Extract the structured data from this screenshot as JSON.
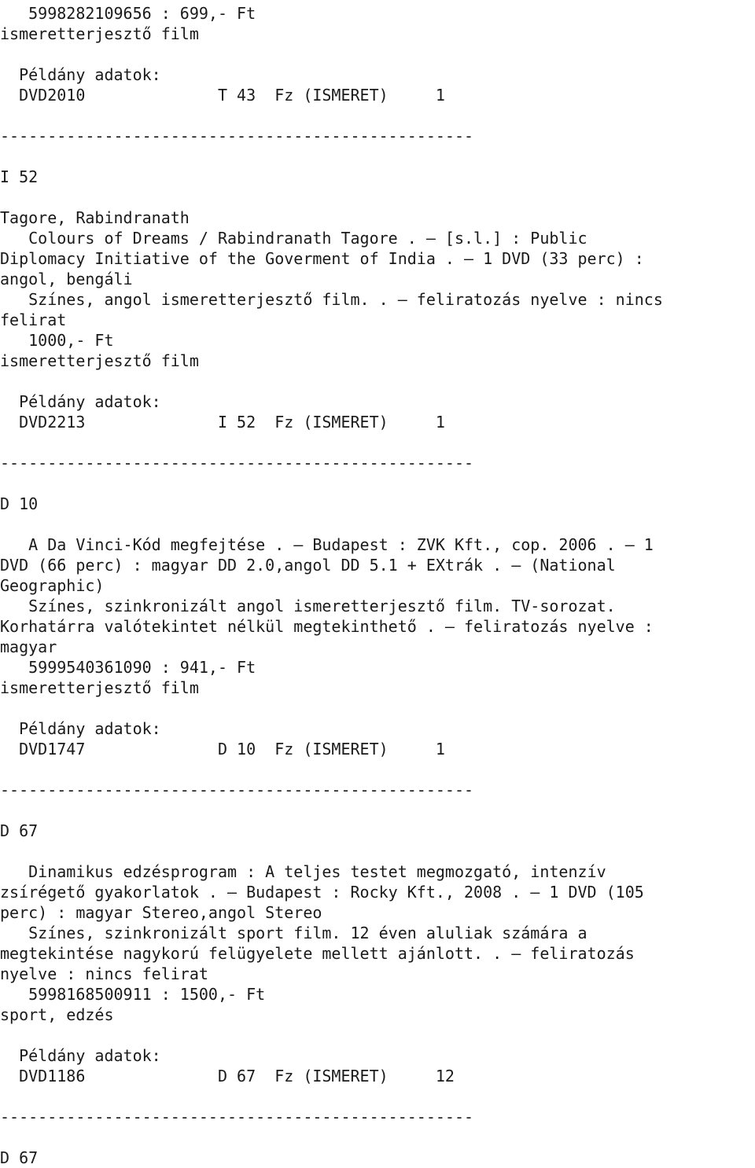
{
  "document": {
    "type": "library-catalog-printout",
    "language": "hu",
    "separator": "--------------------------------------------------",
    "records": [
      {
        "id": "record-0-partial",
        "lines": [
          "   5998282109656 : 699,- Ft",
          "ismeretterjesztő film",
          "",
          "  Példány adatok:",
          "  DVD2010              T 43  Fz (ISMERET)     1",
          "",
          "--------------------------------------------------"
        ],
        "isbn": "5998282109656",
        "price": "699,- Ft",
        "subject": "ismeretterjesztő film",
        "copy_header": "Példány adatok:",
        "copy": {
          "barcode": "DVD2010",
          "shelfmark": "T 43",
          "type": "Fz (ISMERET)",
          "count": "1"
        }
      },
      {
        "id": "record-1",
        "shelfmark_heading": "I 52",
        "author": "Tagore, Rabindranath",
        "lines": [
          "I 52",
          "",
          "Tagore, Rabindranath",
          "   Colours of Dreams / Rabindranath Tagore . — [s.l.] : Public",
          "Diplomacy Initiative of the Goverment of India . — 1 DVD (33 perc) :",
          "angol, bengáli",
          "   Színes, angol ismeretterjesztő film. . — feliratozás nyelve : nincs",
          "felirat",
          "   1000,- Ft",
          "ismeretterjesztő film",
          "",
          "  Példány adatok:",
          "  DVD2213              I 52  Fz (ISMERET)     1",
          "",
          "--------------------------------------------------"
        ],
        "title": "Colours of Dreams",
        "statement_of_responsibility": "Rabindranath Tagore",
        "place": "[s.l.]",
        "publisher": "Public Diplomacy Initiative of the Goverment of India",
        "extent": "1 DVD (33 perc)",
        "languages": "angol, bengáli",
        "note": "Színes, angol ismeretterjesztő film.",
        "subtitle_language": "nincs felirat",
        "price": "1000,- Ft",
        "subject": "ismeretterjesztő film",
        "copy_header": "Példány adatok:",
        "copy": {
          "barcode": "DVD2213",
          "shelfmark": "I 52",
          "type": "Fz (ISMERET)",
          "count": "1"
        }
      },
      {
        "id": "record-2",
        "shelfmark_heading": "D 10",
        "lines": [
          "D 10",
          "",
          "   A Da Vinci-Kód megfejtése . — Budapest : ZVK Kft., cop. 2006 . — 1",
          "DVD (66 perc) : magyar DD 2.0,angol DD 5.1 + EXtrák . — (National",
          "Geographic)",
          "   Színes, szinkronizált angol ismeretterjesztő film. TV-sorozat.",
          "Korhatárra valótekintet nélkül megtekinthető . — feliratozás nyelve :",
          "magyar",
          "   5999540361090 : 941,- Ft",
          "ismeretterjesztő film",
          "",
          "  Példány adatok:",
          "  DVD1747              D 10  Fz (ISMERET)     1",
          "",
          "--------------------------------------------------"
        ],
        "title": "A Da Vinci-Kód megfejtése",
        "place": "Budapest",
        "publisher": "ZVK Kft.",
        "date": "cop. 2006",
        "extent": "1 DVD (66 perc)",
        "sound": "magyar DD 2.0,angol DD 5.1 + EXtrák",
        "series": "(National Geographic)",
        "note": "Színes, szinkronizált angol ismeretterjesztő film. TV-sorozat. Korhatárra valótekintet nélkül megtekinthető",
        "subtitle_language": "magyar",
        "isbn": "5999540361090",
        "price": "941,- Ft",
        "subject": "ismeretterjesztő film",
        "copy_header": "Példány adatok:",
        "copy": {
          "barcode": "DVD1747",
          "shelfmark": "D 10",
          "type": "Fz (ISMERET)",
          "count": "1"
        }
      },
      {
        "id": "record-3",
        "shelfmark_heading": "D 67",
        "lines": [
          "D 67",
          "",
          "   Dinamikus edzésprogram : A teljes testet megmozgató, intenzív",
          "zsírégető gyakorlatok . — Budapest : Rocky Kft., 2008 . — 1 DVD (105",
          "perc) : magyar Stereo,angol Stereo",
          "   Színes, szinkronizált sport film. 12 éven aluliak számára a",
          "megtekintése nagykorú felügyelete mellett ajánlott. . — feliratozás",
          "nyelve : nincs felirat",
          "   5998168500911 : 1500,- Ft",
          "sport, edzés",
          "",
          "  Példány adatok:",
          "  DVD1186              D 67  Fz (ISMERET)     12",
          "",
          "--------------------------------------------------"
        ],
        "title": "Dinamikus edzésprogram",
        "subtitle": "A teljes testet megmozgató, intenzív zsírégető gyakorlatok",
        "place": "Budapest",
        "publisher": "Rocky Kft.",
        "date": "2008",
        "extent": "1 DVD (105 perc)",
        "sound": "magyar Stereo,angol Stereo",
        "note": "Színes, szinkronizált sport film. 12 éven aluliak számára a megtekintése nagykorú felügyelete mellett ajánlott.",
        "subtitle_language": "nincs felirat",
        "isbn": "5998168500911",
        "price": "1500,- Ft",
        "subject": "sport, edzés",
        "copy_header": "Példány adatok:",
        "copy": {
          "barcode": "DVD1186",
          "shelfmark": "D 67",
          "type": "Fz (ISMERET)",
          "count": "12"
        }
      },
      {
        "id": "record-4-partial",
        "shelfmark_heading": "D 67",
        "lines": [
          "D 67"
        ]
      }
    ],
    "full_text": "   5998282109656 : 699,- Ft\nismeretterjesztő film\n\n  Példány adatok:\n  DVD2010              T 43  Fz (ISMERET)     1\n\n--------------------------------------------------\n\nI 52\n\nTagore, Rabindranath\n   Colours of Dreams / Rabindranath Tagore . — [s.l.] : Public\nDiplomacy Initiative of the Goverment of India . — 1 DVD (33 perc) :\nangol, bengáli\n   Színes, angol ismeretterjesztő film. . — feliratozás nyelve : nincs\nfelirat\n   1000,- Ft\nismeretterjesztő film\n\n  Példány adatok:\n  DVD2213              I 52  Fz (ISMERET)     1\n\n--------------------------------------------------\n\nD 10\n\n   A Da Vinci-Kód megfejtése . — Budapest : ZVK Kft., cop. 2006 . — 1\nDVD (66 perc) : magyar DD 2.0,angol DD 5.1 + EXtrák . — (National\nGeographic)\n   Színes, szinkronizált angol ismeretterjesztő film. TV-sorozat.\nKorhatárra valótekintet nélkül megtekinthető . — feliratozás nyelve :\nmagyar\n   5999540361090 : 941,- Ft\nismeretterjesztő film\n\n  Példány adatok:\n  DVD1747              D 10  Fz (ISMERET)     1\n\n--------------------------------------------------\n\nD 67\n\n   Dinamikus edzésprogram : A teljes testet megmozgató, intenzív\nzsírégető gyakorlatok . — Budapest : Rocky Kft., 2008 . — 1 DVD (105\nperc) : magyar Stereo,angol Stereo\n   Színes, szinkronizált sport film. 12 éven aluliak számára a\nmegtekintése nagykorú felügyelete mellett ajánlott. . — feliratozás\nnyelve : nincs felirat\n   5998168500911 : 1500,- Ft\nsport, edzés\n\n  Példány adatok:\n  DVD1186              D 67  Fz (ISMERET)     12\n\n--------------------------------------------------\n\nD 67"
  }
}
